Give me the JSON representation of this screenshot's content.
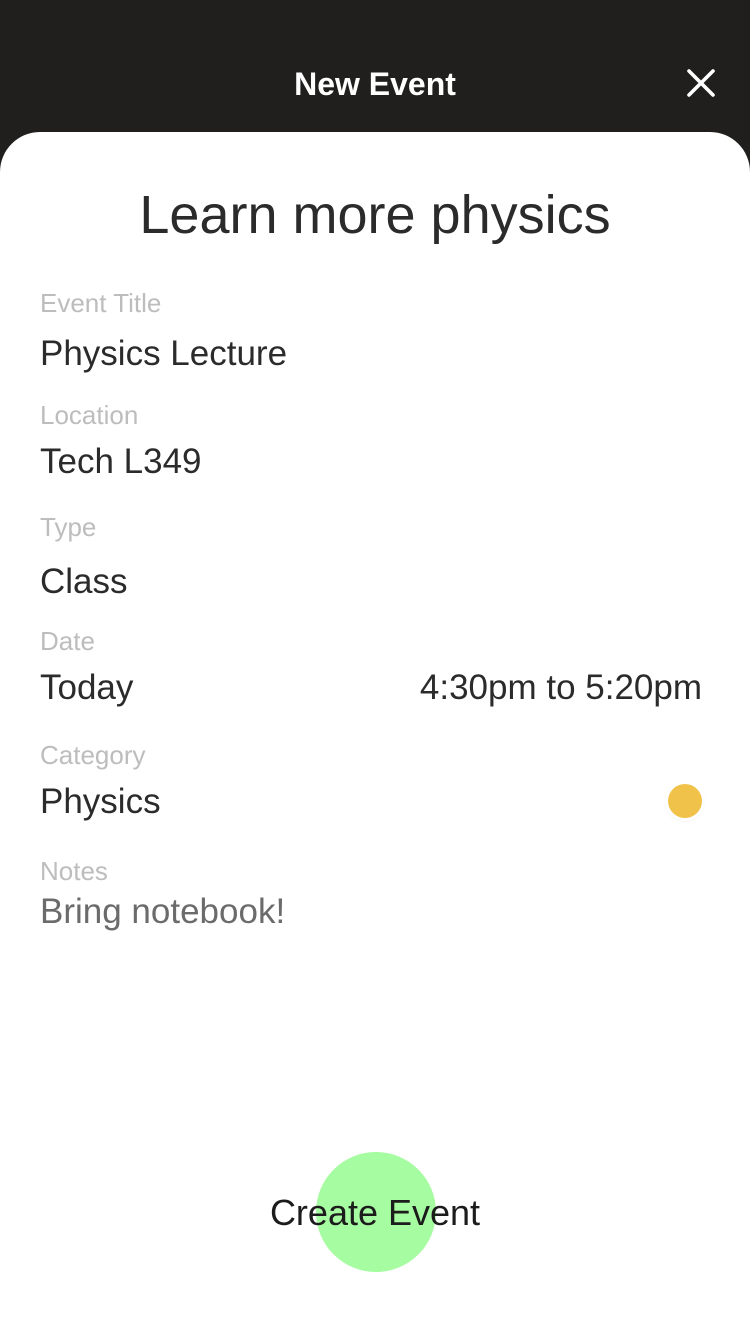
{
  "header": {
    "title": "New Event"
  },
  "event": {
    "heading": "Learn more physics",
    "title_label": "Event Title",
    "title_value": "Physics Lecture",
    "location_label": "Location",
    "location_value": "Tech L349",
    "type_label": "Type",
    "type_value": "Class",
    "date_label": "Date",
    "date_value": "Today",
    "time_value": "4:30pm to 5:20pm",
    "category_label": "Category",
    "category_value": "Physics",
    "category_color": "#f1c24a",
    "notes_label": "Notes",
    "notes_value": "Bring notebook!"
  },
  "actions": {
    "create_label": "Create Event",
    "create_color": "#a6fca0"
  },
  "icons": {
    "close": "close-icon"
  },
  "colors": {
    "header_bg": "#201f1e",
    "label": "#bdbdbd",
    "text": "#2b2b2b"
  }
}
